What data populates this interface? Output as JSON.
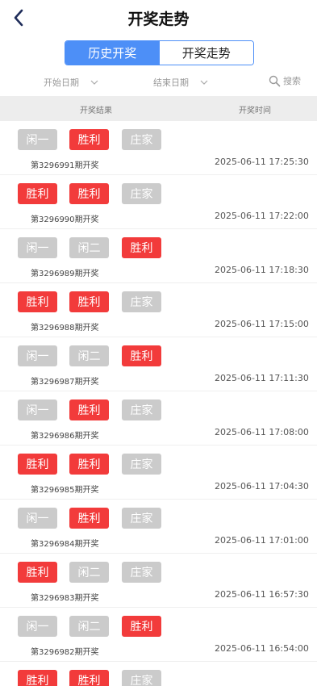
{
  "header": {
    "title": "开奖走势",
    "back_icon": "chevron-left-icon"
  },
  "tabs": [
    {
      "label": "历史开奖",
      "active": true
    },
    {
      "label": "开奖走势",
      "active": false
    }
  ],
  "filters": {
    "start_date": "开始日期",
    "end_date": "结束日期",
    "search": "搜索"
  },
  "table": {
    "col_result": "开奖结果",
    "col_time": "开奖时间"
  },
  "colors": {
    "win": "#f23b3b",
    "inactive": "#cbcbcb",
    "accent": "#4d8ff7"
  },
  "rows": [
    {
      "chips": [
        {
          "t": "闲一",
          "win": false
        },
        {
          "t": "胜利",
          "win": true
        },
        {
          "t": "庄家",
          "win": false
        }
      ],
      "period": "第3296991期开奖",
      "time": "2025-06-11 17:25:30"
    },
    {
      "chips": [
        {
          "t": "胜利",
          "win": true
        },
        {
          "t": "胜利",
          "win": true
        },
        {
          "t": "庄家",
          "win": false
        }
      ],
      "period": "第3296990期开奖",
      "time": "2025-06-11 17:22:00"
    },
    {
      "chips": [
        {
          "t": "闲一",
          "win": false
        },
        {
          "t": "闲二",
          "win": false
        },
        {
          "t": "胜利",
          "win": true
        }
      ],
      "period": "第3296989期开奖",
      "time": "2025-06-11 17:18:30"
    },
    {
      "chips": [
        {
          "t": "胜利",
          "win": true
        },
        {
          "t": "胜利",
          "win": true
        },
        {
          "t": "庄家",
          "win": false
        }
      ],
      "period": "第3296988期开奖",
      "time": "2025-06-11 17:15:00"
    },
    {
      "chips": [
        {
          "t": "闲一",
          "win": false
        },
        {
          "t": "闲二",
          "win": false
        },
        {
          "t": "胜利",
          "win": true
        }
      ],
      "period": "第3296987期开奖",
      "time": "2025-06-11 17:11:30"
    },
    {
      "chips": [
        {
          "t": "闲一",
          "win": false
        },
        {
          "t": "胜利",
          "win": true
        },
        {
          "t": "庄家",
          "win": false
        }
      ],
      "period": "第3296986期开奖",
      "time": "2025-06-11 17:08:00"
    },
    {
      "chips": [
        {
          "t": "胜利",
          "win": true
        },
        {
          "t": "胜利",
          "win": true
        },
        {
          "t": "庄家",
          "win": false
        }
      ],
      "period": "第3296985期开奖",
      "time": "2025-06-11 17:04:30"
    },
    {
      "chips": [
        {
          "t": "闲一",
          "win": false
        },
        {
          "t": "胜利",
          "win": true
        },
        {
          "t": "庄家",
          "win": false
        }
      ],
      "period": "第3296984期开奖",
      "time": "2025-06-11 17:01:00"
    },
    {
      "chips": [
        {
          "t": "胜利",
          "win": true
        },
        {
          "t": "闲二",
          "win": false
        },
        {
          "t": "庄家",
          "win": false
        }
      ],
      "period": "第3296983期开奖",
      "time": "2025-06-11 16:57:30"
    },
    {
      "chips": [
        {
          "t": "闲一",
          "win": false
        },
        {
          "t": "闲二",
          "win": false
        },
        {
          "t": "胜利",
          "win": true
        }
      ],
      "period": "第3296982期开奖",
      "time": "2025-06-11 16:54:00"
    },
    {
      "chips": [
        {
          "t": "胜利",
          "win": true
        },
        {
          "t": "胜利",
          "win": true
        },
        {
          "t": "庄家",
          "win": false
        }
      ],
      "period": "",
      "time": ""
    }
  ]
}
